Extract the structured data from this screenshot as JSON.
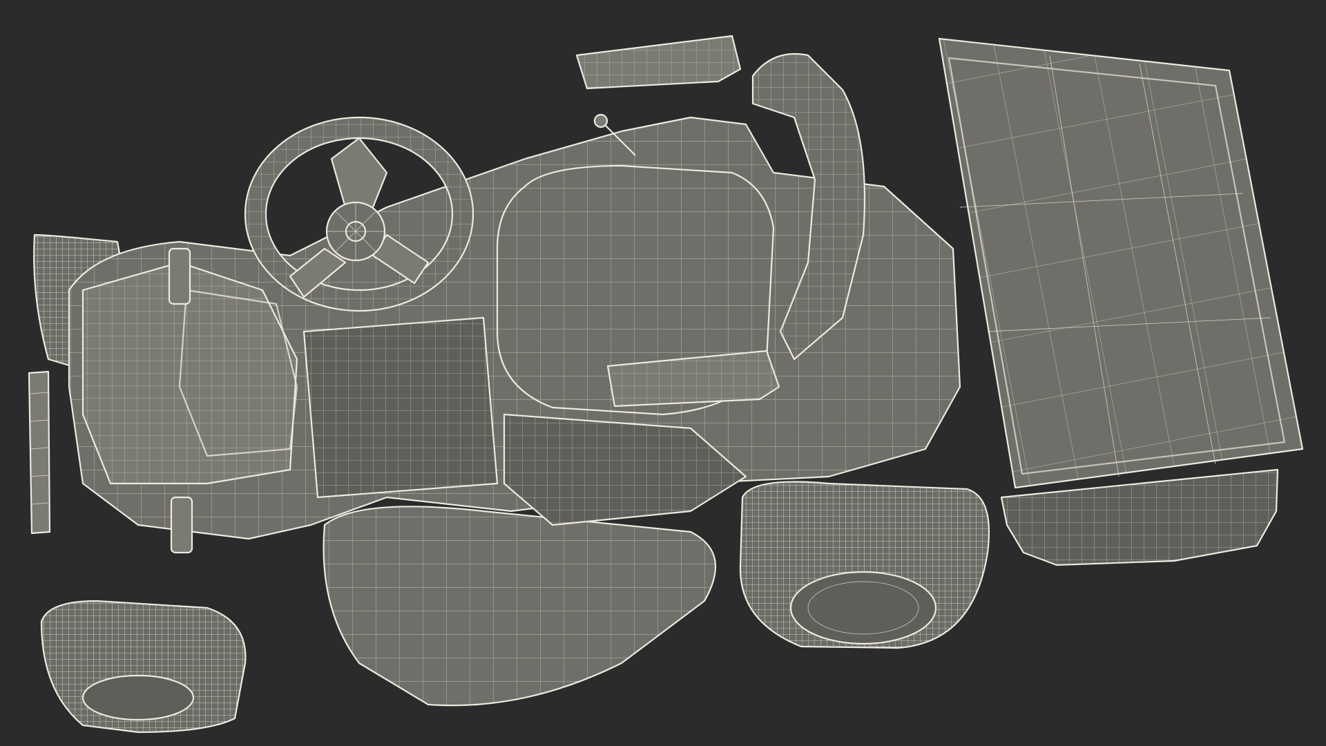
{
  "scene": {
    "subject": "riding-lawn-mower-wireframe",
    "view": "top-down",
    "render_style": "wireframe-on-shaded",
    "colors": {
      "background": "#2b2b2b",
      "body": "#6f6e68",
      "body_dark": "#5f5e59",
      "wire": "#e6e5dc"
    },
    "parts": [
      "grass-catcher",
      "seat",
      "seat-backrest",
      "armrest-left",
      "armrest-right",
      "steering-wheel",
      "hood",
      "front-bumper",
      "mower-deck",
      "front-left-tire",
      "front-right-tire",
      "rear-left-tire",
      "rear-right-tire",
      "control-lever"
    ]
  }
}
